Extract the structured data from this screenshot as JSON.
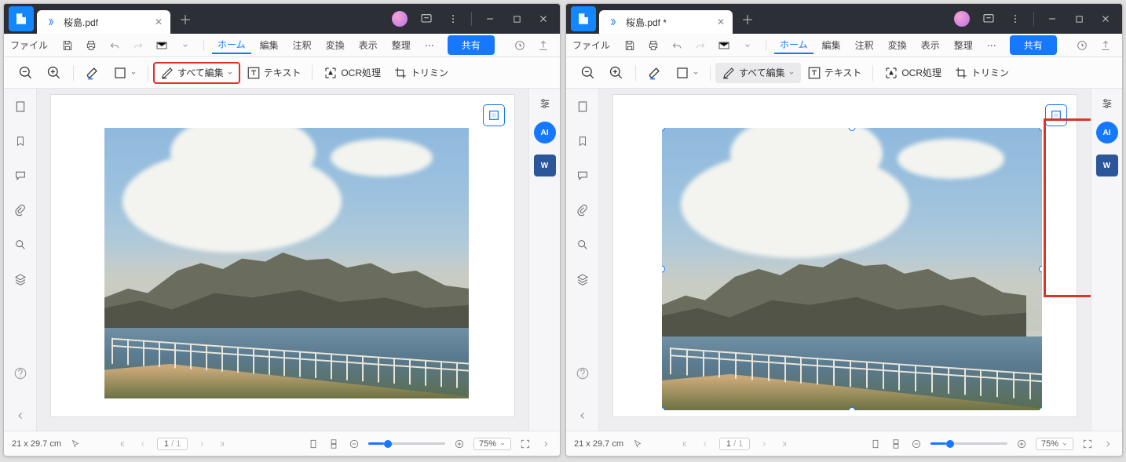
{
  "left": {
    "tab_title": "桜島.pdf",
    "menus": {
      "file": "ファイル",
      "home": "ホーム",
      "edit": "編集",
      "comment": "注釈",
      "convert": "変換",
      "view": "表示",
      "organize": "整理",
      "more": "⋯",
      "share": "共有"
    },
    "toolbar": {
      "edit_all": "すべて編集",
      "text": "テキスト",
      "ocr": "OCR処理",
      "trim": "トリミン"
    },
    "status": {
      "dims": "21 x 29.7 cm",
      "page": "1",
      "page_total": "/ 1",
      "zoom": "75%"
    }
  },
  "right": {
    "tab_title": "桜島.pdf *",
    "menus": {
      "file": "ファイル",
      "home": "ホーム",
      "edit": "編集",
      "comment": "注釈",
      "convert": "変換",
      "view": "表示",
      "organize": "整理",
      "more": "⋯",
      "share": "共有"
    },
    "toolbar": {
      "edit_all": "すべて編集",
      "text": "テキスト",
      "ocr": "OCR処理",
      "trim": "トリミン"
    },
    "status": {
      "dims": "21 x 29.7 cm",
      "page": "1",
      "page_total": "/ 1",
      "zoom": "75%"
    }
  },
  "rightpanel": {
    "ai": "AI",
    "word": "W"
  }
}
